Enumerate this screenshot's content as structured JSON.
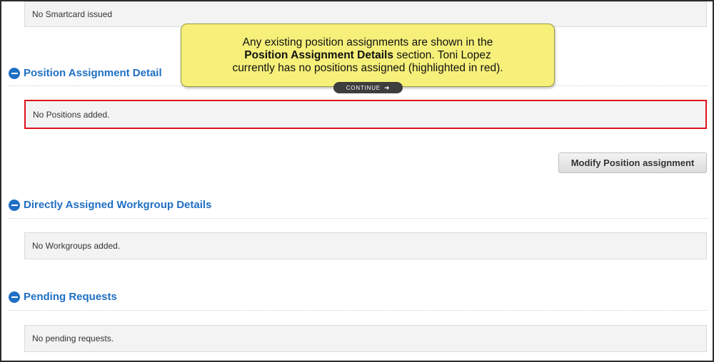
{
  "smartcard": {
    "text": "No Smartcard issued"
  },
  "position_section": {
    "title": "Position Assignment Detail",
    "empty_text": "No Positions added.",
    "modify_button": "Modify Position assignment"
  },
  "workgroup_section": {
    "title": "Directly Assigned Workgroup Details",
    "empty_text": "No Workgroups added."
  },
  "pending_section": {
    "title": "Pending Requests",
    "empty_text": "No pending requests."
  },
  "callout": {
    "line1": "Any existing position assignments are shown in the",
    "bold": "Position Assignment Details",
    "line2_rest": " section. Toni Lopez",
    "line3": "currently has no positions assigned (highlighted in red).",
    "continue_label": "CONTINUE",
    "continue_icon": "arrow-right-icon"
  },
  "colors": {
    "section_blue": "#1f6fc4",
    "highlight_red": "#e0121b",
    "callout_yellow": "#f6f07a"
  }
}
